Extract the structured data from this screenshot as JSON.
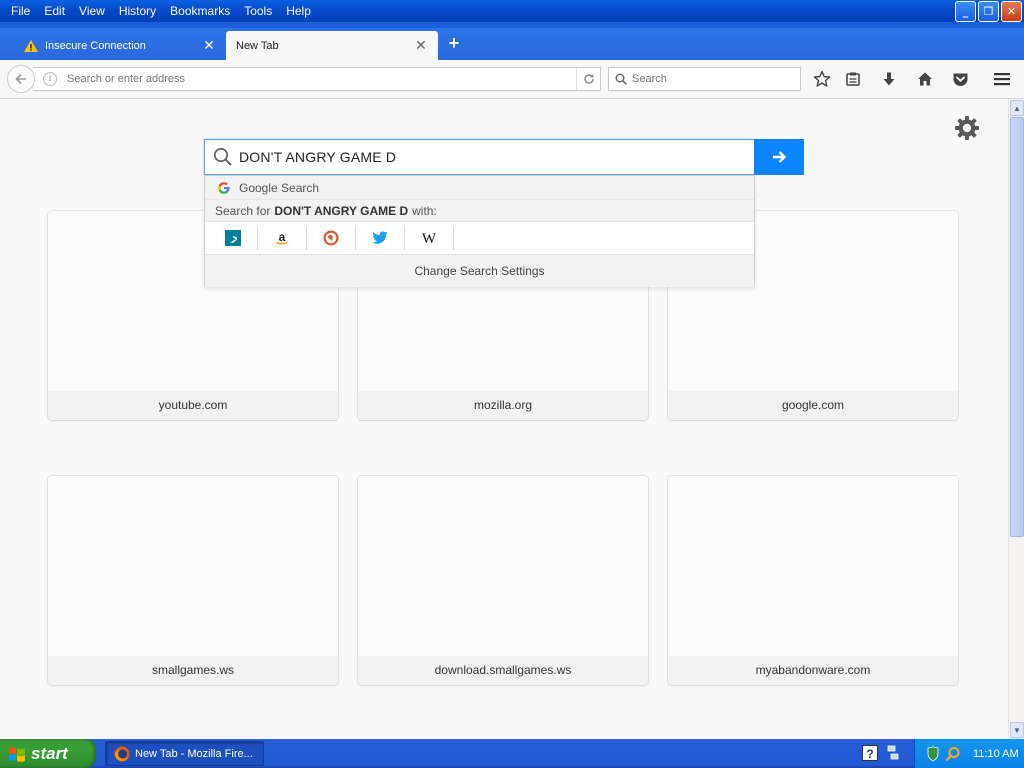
{
  "menu": [
    "File",
    "Edit",
    "View",
    "History",
    "Bookmarks",
    "Tools",
    "Help"
  ],
  "tabs": [
    {
      "title": "Insecure Connection",
      "active": false
    },
    {
      "title": "New Tab",
      "active": true
    }
  ],
  "navbar": {
    "url_placeholder": "Search or enter address",
    "search_placeholder": "Search"
  },
  "newtab_search": {
    "query": "DON'T ANGRY GAME D",
    "google_label": "Google Search",
    "search_for_prefix": "Search for",
    "search_for_query": "DON'T ANGRY GAME D",
    "search_for_suffix": "with:",
    "engines": [
      "bing-icon",
      "amazon-icon",
      "duckduckgo-icon",
      "twitter-icon",
      "wikipedia-icon"
    ],
    "settings_label": "Change Search Settings"
  },
  "tiles": [
    {
      "label": "youtube.com"
    },
    {
      "label": "mozilla.org"
    },
    {
      "label": "google.com"
    },
    {
      "label": "smallgames.ws"
    },
    {
      "label": "download.smallgames.ws"
    },
    {
      "label": "myabandonware.com"
    }
  ],
  "taskbar": {
    "start_label": "start",
    "task_item": "New Tab - Mozilla Fire...",
    "clock": "11:10 AM"
  },
  "colors": {
    "accent": "#0a84ff",
    "titlebar": "#0548c9",
    "start_green": "#379e35"
  }
}
